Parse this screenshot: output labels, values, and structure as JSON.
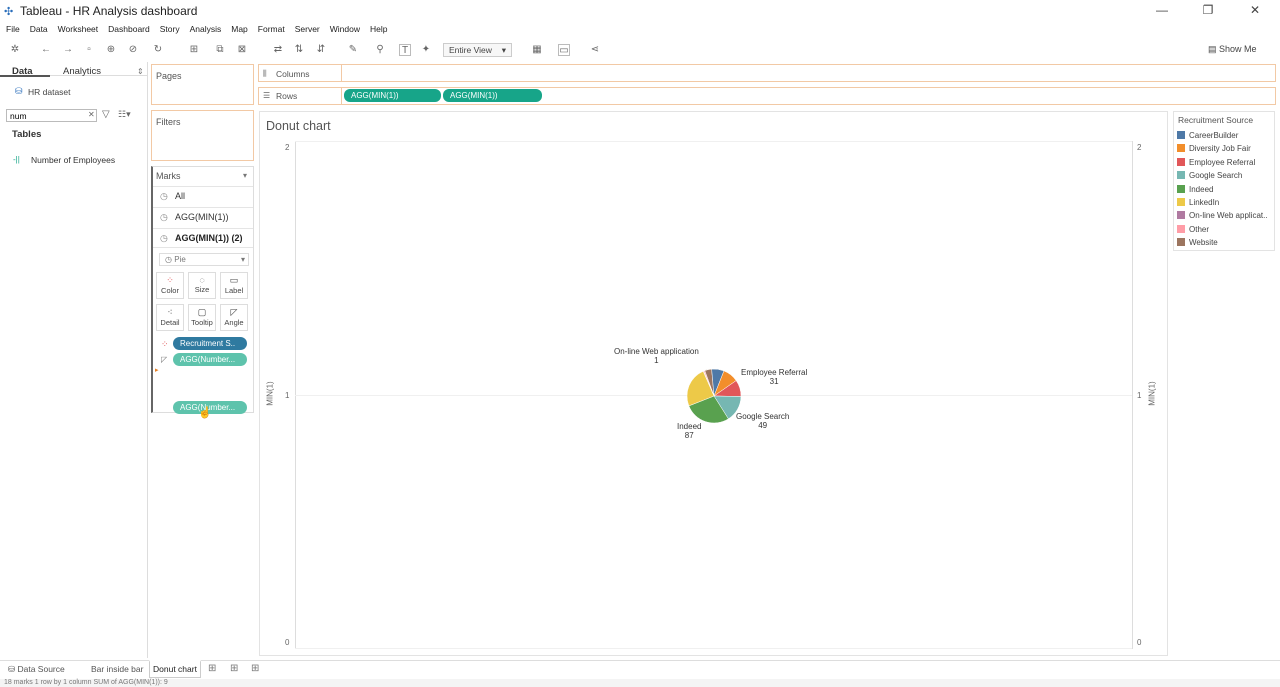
{
  "window": {
    "title": "Tableau - HR Analysis dashboard"
  },
  "menu": [
    "File",
    "Data",
    "Worksheet",
    "Dashboard",
    "Story",
    "Analysis",
    "Map",
    "Format",
    "Server",
    "Window",
    "Help"
  ],
  "toolbar": {
    "fit": "Entire View",
    "show_me": "Show Me"
  },
  "left": {
    "tab_data": "Data",
    "tab_analytics": "Analytics",
    "datasource": "HR dataset",
    "search_value": "num",
    "tables_header": "Tables",
    "field": "Number of Employees"
  },
  "cards": {
    "pages": "Pages",
    "filters": "Filters",
    "marks": "Marks"
  },
  "marks": {
    "all": "All",
    "m1": "AGG(MIN(1))",
    "m2": "AGG(MIN(1)) (2)",
    "type": "Pie",
    "buttons": {
      "color": "Color",
      "size": "Size",
      "label": "Label",
      "detail": "Detail",
      "tooltip": "Tooltip",
      "angle": "Angle"
    },
    "pill_color": "Recruitment S..",
    "pill_angle": "AGG(Number...",
    "pill_drag": "AGG(Number..."
  },
  "shelves": {
    "columns": "Columns",
    "rows": "Rows",
    "row_pill1": "AGG(MIN(1))",
    "row_pill2": "AGG(MIN(1))"
  },
  "view": {
    "title": "Donut chart",
    "axis_label": "MIN(1)",
    "ticks": [
      "2",
      "1",
      "0"
    ]
  },
  "legend": {
    "title": "Recruitment Source",
    "items": [
      {
        "name": "CareerBuilder",
        "color": "#4e79a7"
      },
      {
        "name": "Diversity Job Fair",
        "color": "#f28e2b"
      },
      {
        "name": "Employee Referral",
        "color": "#e15759"
      },
      {
        "name": "Google Search",
        "color": "#76b7b2"
      },
      {
        "name": "Indeed",
        "color": "#59a14f"
      },
      {
        "name": "LinkedIn",
        "color": "#edc948"
      },
      {
        "name": "On-line Web applicat..",
        "color": "#b07aa1"
      },
      {
        "name": "Other",
        "color": "#ff9da7"
      },
      {
        "name": "Website",
        "color": "#9c755f"
      }
    ]
  },
  "pie_labels": {
    "online_name": "On-line Web application",
    "online_val": "1",
    "referral_name": "Employee Referral",
    "referral_val": "31",
    "google_name": "Google Search",
    "google_val": "49",
    "indeed_name": "Indeed",
    "indeed_val": "87"
  },
  "chart_data": {
    "type": "pie",
    "categories": [
      "CareerBuilder",
      "Diversity Job Fair",
      "Employee Referral",
      "Google Search",
      "Indeed",
      "LinkedIn",
      "On-line Web application",
      "Other",
      "Website"
    ],
    "values": [
      23,
      29,
      31,
      49,
      87,
      76,
      1,
      2,
      13
    ],
    "colors": [
      "#4e79a7",
      "#f28e2b",
      "#e15759",
      "#76b7b2",
      "#59a14f",
      "#edc948",
      "#b07aa1",
      "#ff9da7",
      "#9c755f"
    ]
  },
  "sheets": {
    "datasource": "Data Source",
    "s1": "Bar inside bar",
    "s2": "Donut chart"
  },
  "status": {
    "text": "18 marks    1 row by 1 column    SUM of AGG(MIN(1)): 9"
  }
}
